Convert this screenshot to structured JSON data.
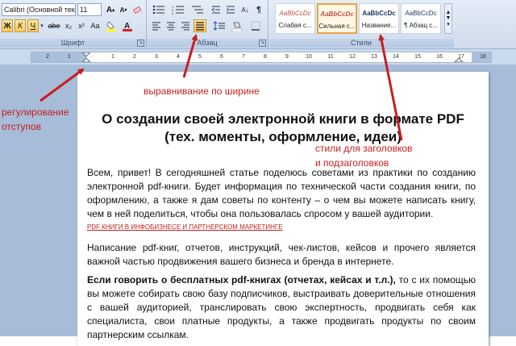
{
  "ribbon": {
    "font_name": "Calibri (Основной текс",
    "font_size": "11",
    "font_group_label": "Шрифт",
    "paragraph_group_label": "Абзац",
    "styles_group_label": "Стили",
    "format_buttons": [
      "Ж",
      "К",
      "Ч",
      "abe",
      "x₂",
      "x²",
      "Aa"
    ],
    "styles": [
      {
        "sample": "AaBbCcDc",
        "name": "Слабая с...",
        "sample_color": "#c0504d"
      },
      {
        "sample": "AaBbCcDc",
        "name": "Сильная с...",
        "sample_color": "#c0504d"
      },
      {
        "sample": "AaBbCcDc",
        "name": "Название...",
        "sample_color": "#17365d"
      },
      {
        "sample": "AaBbCcDc",
        "name": "¶ Абзац с...",
        "sample_color": "#17365d"
      }
    ],
    "ruler_numbers": [
      "2",
      "1",
      "",
      "1",
      "2",
      "3",
      "4",
      "5",
      "6",
      "7",
      "8",
      "9",
      "10",
      "11",
      "12",
      "13",
      "14",
      "15",
      "16",
      "17",
      "18"
    ]
  },
  "document": {
    "title_line1": "О создании своей электронной книги в формате PDF",
    "title_line2": "(тех. моменты, оформление, идеи)",
    "para1": "Всем, привет! В сегодняшней статье поделюсь советами из практики по созданию электронной pdf-книги. Будет информация по технической части создания книги, по оформлению, а также я дам советы по контенту – о чем вы можете написать книгу, чем в ней поделиться, чтобы она пользовалась спросом у вашей аудитории.",
    "link_line": "PDF КНИГИ В ИНФОБИЗНЕСЕ И ПАРТНЕРСКОМ МАРКЕТИНГЕ",
    "para2": "Написание pdf-книг, отчетов, инструкций, чек-листов, кейсов и прочего является важной частью продвижения вашего бизнеса и бренда в интернете.",
    "para3_bold": "Если говорить о бесплатных pdf-книгах (отчетах, кейсах и т.л.),",
    "para3_rest": " то с их помощью вы можете собирать свою базу подписчиков, выстраивать доверительные отношения с вашей аудиторией, транслировать свою экспертность, продвигать себя как специалиста, свои платные продукты, а также продвигать продукты по своим партнерским ссылкам."
  },
  "annotations": {
    "justify": "выравнивание по ширине",
    "indent_line1": "регулирование",
    "indent_line2": "отступов",
    "styles_line1": "стили для заголовков",
    "styles_line2": "и подзаголовков"
  },
  "colors": {
    "annotation_red": "#c81e1e",
    "ribbon_bg": "#cfdced",
    "canvas_bg": "#a7bcd8"
  }
}
